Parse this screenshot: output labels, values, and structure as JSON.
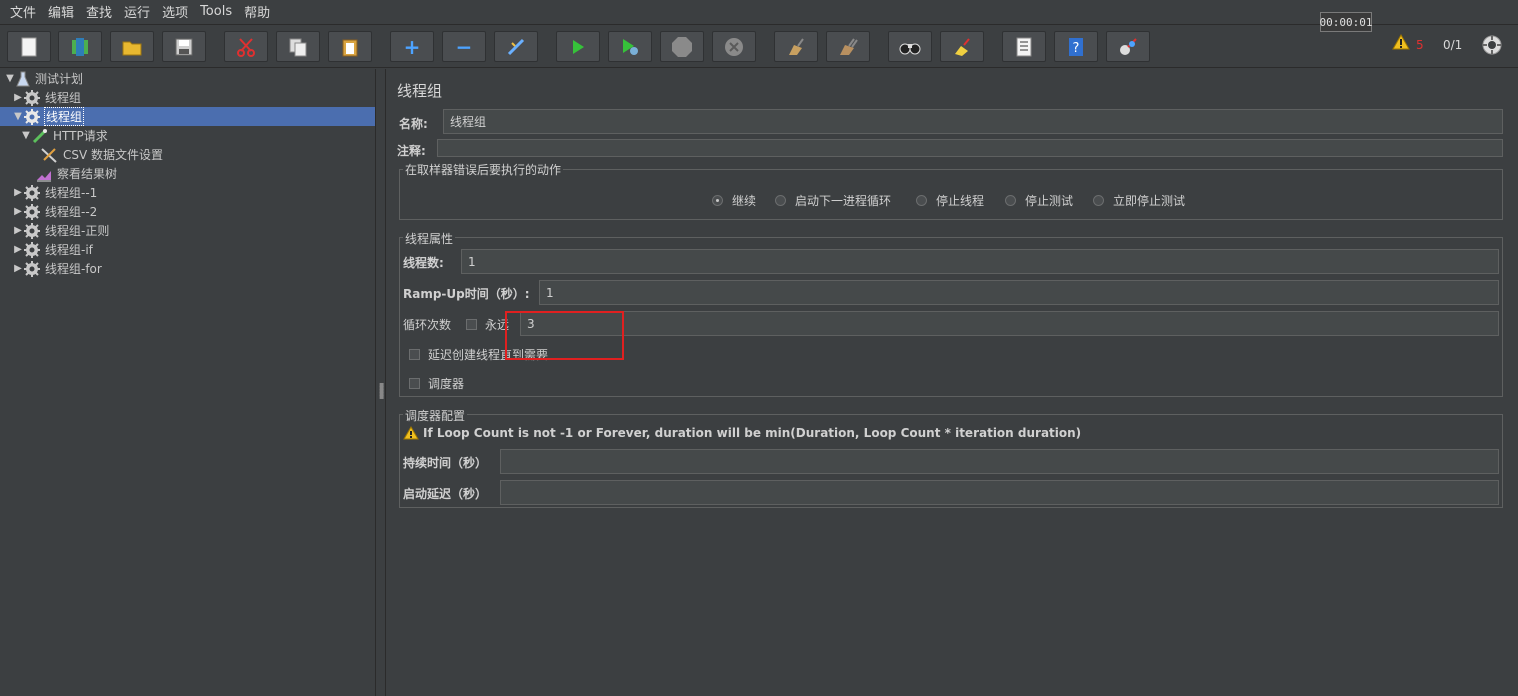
{
  "menu": [
    "文件",
    "编辑",
    "查找",
    "运行",
    "选项",
    "Tools",
    "帮助"
  ],
  "toolbar": {
    "buttons": [
      "new-icon",
      "templates-icon",
      "open-icon",
      "save-icon",
      "cut-icon",
      "copy-icon",
      "paste-icon",
      "expand-icon",
      "collapse-icon",
      "toggle-icon",
      "start-icon",
      "start-no-pause-icon",
      "stop-icon",
      "shutdown-icon",
      "clear-icon",
      "clear-all-icon",
      "search-icon",
      "reset-search-icon",
      "function-helper-icon",
      "help-icon",
      "remote-icon"
    ],
    "timer": "00:00:01",
    "warning_count": "5",
    "threads": "0/1"
  },
  "tree": {
    "items": [
      {
        "label": "测试计划",
        "arrow": "▼",
        "icon": "test-plan-icon"
      },
      {
        "label": "线程组",
        "arrow": "▶",
        "icon": "gear-icon"
      },
      {
        "label": "线程组",
        "arrow": "▼",
        "icon": "gear-icon",
        "selected": true
      },
      {
        "label": "HTTP请求",
        "arrow": "▼",
        "icon": "sampler-icon"
      },
      {
        "label": "CSV 数据文件设置",
        "arrow": "",
        "icon": "config-icon"
      },
      {
        "label": "察看结果树",
        "arrow": "",
        "icon": "listener-icon"
      },
      {
        "label": "线程组--1",
        "arrow": "▶",
        "icon": "gear-icon"
      },
      {
        "label": "线程组--2",
        "arrow": "▶",
        "icon": "gear-icon"
      },
      {
        "label": "线程组-正则",
        "arrow": "▶",
        "icon": "gear-icon"
      },
      {
        "label": "线程组-if",
        "arrow": "▶",
        "icon": "gear-icon"
      },
      {
        "label": "线程组-for",
        "arrow": "▶",
        "icon": "gear-icon"
      }
    ]
  },
  "panel": {
    "title": "线程组",
    "name_label": "名称:",
    "name_value": "线程组",
    "comment_label": "注释:",
    "comment_value": "",
    "error_group_title": "在取样器错误后要执行的动作",
    "error_actions": [
      "继续",
      "启动下一进程循环",
      "停止线程",
      "停止测试",
      "立即停止测试"
    ],
    "error_action_selected": 0,
    "thread_props_title": "线程属性",
    "threads_label": "线程数:",
    "threads_value": "1",
    "rampup_label": "Ramp-Up时间（秒）:",
    "rampup_value": "1",
    "loop_label": "循环次数",
    "forever_label": "永远",
    "loop_value": "3",
    "delay_label": "延迟创建线程直到需要",
    "scheduler_label": "调度器",
    "scheduler_group_title": "调度器配置",
    "scheduler_note": "If Loop Count is not -1 or Forever, duration will be min(Duration, Loop Count * iteration duration)",
    "duration_label": "持续时间（秒）",
    "duration_value": "",
    "startup_delay_label": "启动延迟（秒）",
    "startup_delay_value": ""
  },
  "colors": {
    "background": "#3c3f41",
    "selection": "#4b6eaf",
    "highlight_box": "#e02020",
    "warning": "#e03030"
  }
}
